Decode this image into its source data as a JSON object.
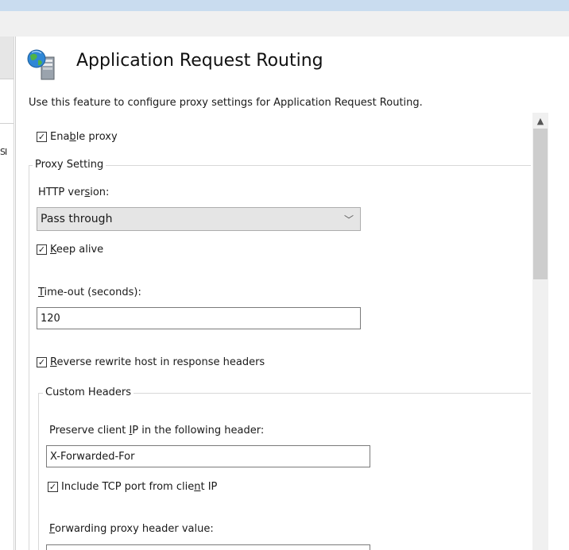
{
  "page": {
    "title": "Application Request Routing",
    "description": "Use this feature to configure proxy settings for Application Request Routing.",
    "left_pane_clip": "SI"
  },
  "enable_proxy": {
    "pre": "Ena",
    "u": "b",
    "post": "le proxy",
    "checked": true
  },
  "proxy_setting": {
    "group_title": "Proxy Setting",
    "http_version": {
      "pre": "HTTP ver",
      "u": "s",
      "post": "ion:",
      "value": "Pass through"
    },
    "keep_alive": {
      "pre": "",
      "u": "K",
      "post": "eep alive",
      "checked": true
    },
    "timeout": {
      "pre": "",
      "u": "T",
      "post": "ime-out (seconds):",
      "value": "120"
    },
    "reverse_rewrite": {
      "pre": "",
      "u": "R",
      "post": "everse rewrite host in response headers",
      "checked": true
    },
    "custom_headers": {
      "group_title": "Custom Headers",
      "preserve_ip": {
        "pre": "Preserve client ",
        "u": "I",
        "post": "P in the following header:",
        "value": "X-Forwarded-For"
      },
      "include_port": {
        "pre": "Include TCP port from clie",
        "u": "n",
        "post": "t IP",
        "checked": true
      },
      "forwarding_header": {
        "pre": "",
        "u": "F",
        "post": "orwarding proxy header value:"
      }
    }
  },
  "check_glyph": "✓",
  "icons": {
    "header": "globe-server-icon",
    "dropdown": "chevron-down-icon",
    "scroll_up": "chevron-up-icon"
  }
}
